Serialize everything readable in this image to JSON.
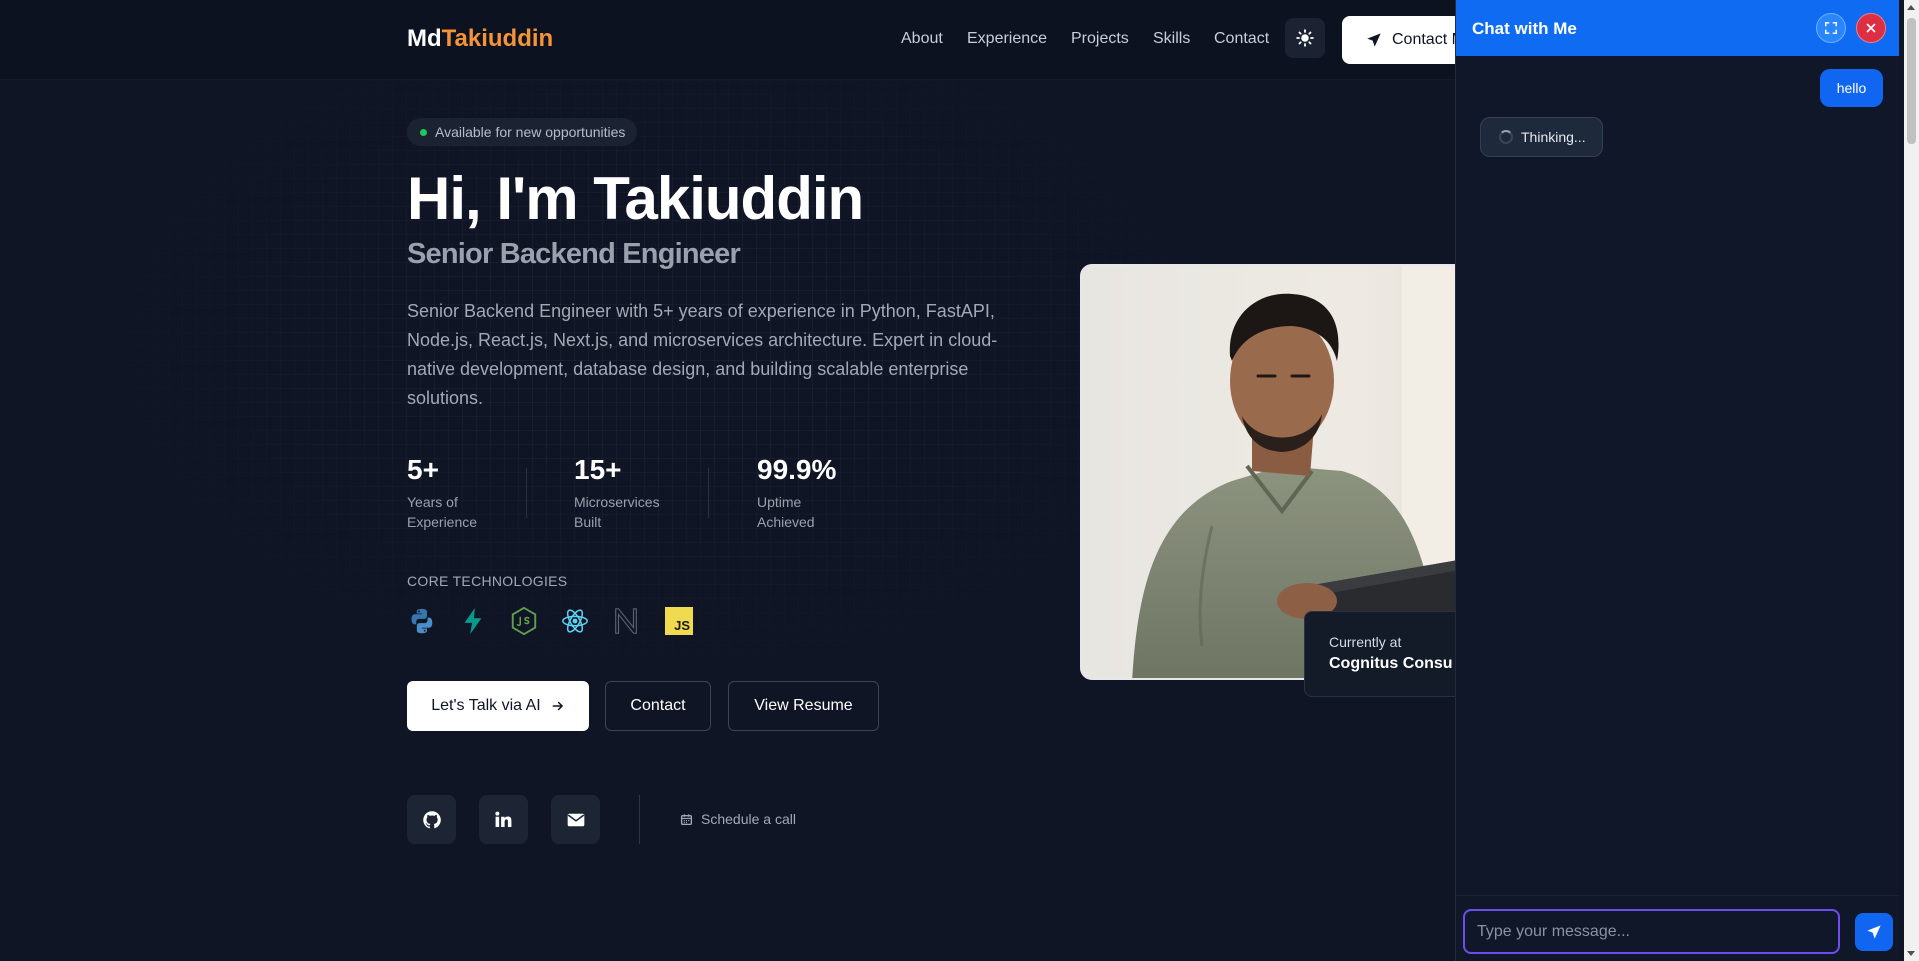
{
  "header": {
    "logo_first": "Md",
    "logo_second": "Takiuddin",
    "nav": [
      "About",
      "Experience",
      "Projects",
      "Skills",
      "Contact"
    ],
    "theme_icon": "sun-icon",
    "contact_button": "Contact M",
    "contact_icon": "paper-plane-icon"
  },
  "hero": {
    "badge": "Available for new opportunities",
    "title": "Hi, I'm Takiuddin",
    "subtitle": "Senior Backend Engineer",
    "description": "Senior Backend Engineer with 5+ years of experience in Python, FastAPI, Node.js, React.js, Next.js, and microservices architecture. Expert in cloud-native development, database design, and building scalable enterprise solutions.",
    "stats": [
      {
        "value": "5+",
        "label_line1": "Years of",
        "label_line2": "Experience"
      },
      {
        "value": "15+",
        "label_line1": "Microservices",
        "label_line2": "Built"
      },
      {
        "value": "99.9%",
        "label_line1": "Uptime",
        "label_line2": "Achieved"
      }
    ],
    "core_label": "CORE TECHNOLOGIES",
    "technologies": [
      "python-icon",
      "fastapi-icon",
      "nodejs-icon",
      "react-icon",
      "nextjs-icon",
      "javascript-icon"
    ],
    "js_icon_text": "JS",
    "buttons": {
      "talk": "Let's Talk via AI",
      "contact": "Contact",
      "resume": "View Resume"
    },
    "socials": [
      "github-icon",
      "linkedin-icon",
      "mail-icon"
    ],
    "schedule": "Schedule a call"
  },
  "profile": {
    "current_label": "Currently at",
    "current_company": "Cognitus Consu"
  },
  "chat": {
    "title": "Chat with Me",
    "user_message": "hello",
    "bot_status": "Thinking...",
    "input_placeholder": "Type your message..."
  },
  "colors": {
    "background": "#0f1524",
    "accent_orange": "#f59337",
    "chat_blue": "#0f6cf2",
    "status_green": "#22c55e",
    "close_red": "#dc2f43"
  }
}
